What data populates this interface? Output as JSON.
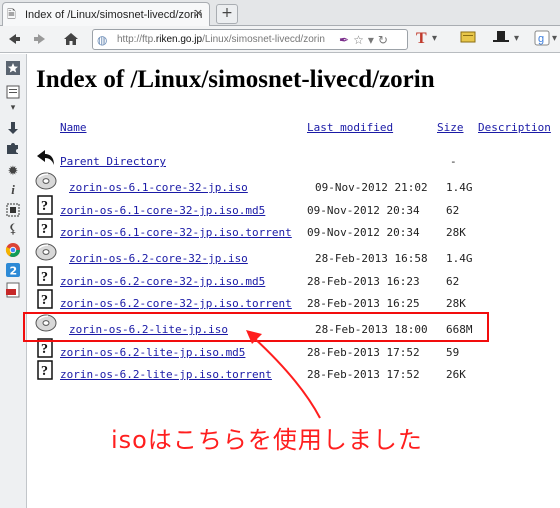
{
  "tab": {
    "title": "Index of /Linux/simosnet-livecd/zorin",
    "close": "✕",
    "new_tab": "+"
  },
  "nav": {
    "url_prefix": "http://ftp.",
    "url_domain": "riken.go.jp",
    "url_path": "/Linux/simosnet-livecd/zorin"
  },
  "page": {
    "title": "Index of /Linux/simosnet-livecd/zorin",
    "headers": {
      "name": "Name",
      "last_modified": "Last modified",
      "size": "Size",
      "description": "Description"
    },
    "rows": [
      {
        "icon": "back-arrow-icon",
        "name": "Parent Directory",
        "date": "",
        "size": "-"
      },
      {
        "icon": "cd-icon",
        "name": "zorin-os-6.1-core-32-jp.iso",
        "date": "09-Nov-2012 21:02",
        "size": "1.4G"
      },
      {
        "icon": "unknown-file-icon",
        "name": "zorin-os-6.1-core-32-jp.iso.md5",
        "date": "09-Nov-2012 20:34",
        "size": "62"
      },
      {
        "icon": "unknown-file-icon",
        "name": "zorin-os-6.1-core-32-jp.iso.torrent",
        "date": "09-Nov-2012 20:34",
        "size": "28K"
      },
      {
        "icon": "cd-icon",
        "name": "zorin-os-6.2-core-32-jp.iso",
        "date": "28-Feb-2013 16:58",
        "size": "1.4G"
      },
      {
        "icon": "unknown-file-icon",
        "name": "zorin-os-6.2-core-32-jp.iso.md5",
        "date": "28-Feb-2013 16:23",
        "size": "62"
      },
      {
        "icon": "unknown-file-icon",
        "name": "zorin-os-6.2-core-32-jp.iso.torrent",
        "date": "28-Feb-2013 16:25",
        "size": "28K"
      },
      {
        "icon": "cd-icon",
        "name": "zorin-os-6.2-lite-jp.iso",
        "date": "28-Feb-2013 18:00",
        "size": "668M"
      },
      {
        "icon": "unknown-file-icon",
        "name": "zorin-os-6.2-lite-jp.iso.md5",
        "date": "28-Feb-2013 17:52",
        "size": "59"
      },
      {
        "icon": "unknown-file-icon",
        "name": "zorin-os-6.2-lite-jp.iso.torrent",
        "date": "28-Feb-2013 17:52",
        "size": "26K"
      }
    ]
  },
  "annotation": {
    "text": "isoはこちらを使用しました",
    "color": "#ff1e1e"
  },
  "toolbar": {
    "t_icon": "T"
  }
}
